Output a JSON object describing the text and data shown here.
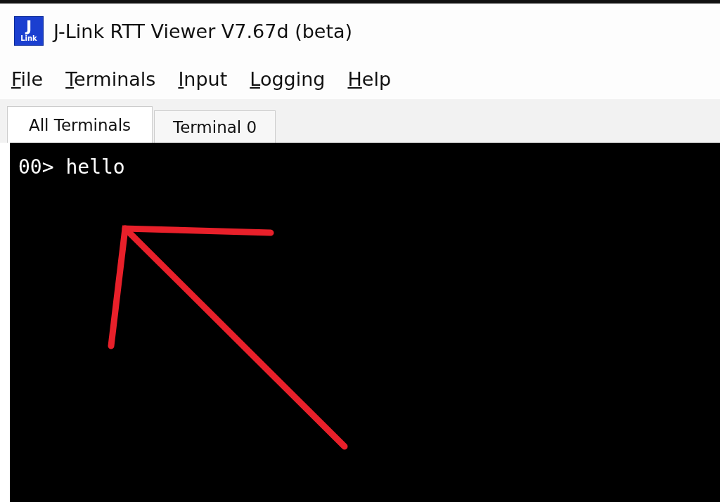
{
  "window": {
    "title": "J-Link RTT Viewer V7.67d (beta)",
    "logo_text": "J",
    "logo_subtext": "Link"
  },
  "menu": [
    {
      "label": "File"
    },
    {
      "label": "Terminals"
    },
    {
      "label": "Input"
    },
    {
      "label": "Logging"
    },
    {
      "label": "Help"
    }
  ],
  "tabs": [
    {
      "label": "All Terminals",
      "selected": true
    },
    {
      "label": "Terminal 0",
      "selected": false
    }
  ],
  "terminal": {
    "lines": [
      "00> hello"
    ]
  }
}
